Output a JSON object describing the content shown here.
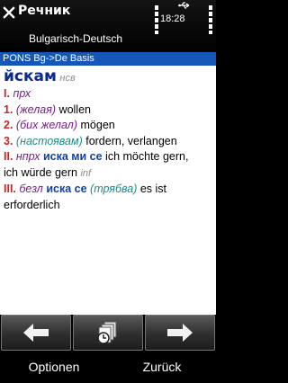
{
  "status": {
    "app_title": "Речник",
    "subtitle": "Bulgarisch-Deutsch",
    "time": "18:28"
  },
  "dictionary_bar": "PONS Bg->De Basis",
  "entry": {
    "headword": "йскам",
    "pos": "нсв",
    "sense_I_num": "I.",
    "sense_I_gram": "прх",
    "s1_num": "1.",
    "s1_gram": "(желая)",
    "s1_trans": "wollen",
    "s2_num": "2.",
    "s2_gram": "(бих желал)",
    "s2_trans": "mögen",
    "s3_num": "3.",
    "s3_gram": "(настоявам)",
    "s3_trans": "fordern, verlangen",
    "sense_II_num": "II.",
    "sense_II_gram": "нпрх",
    "sense_II_example": "иска ми се",
    "sense_II_trans_a": "ich möchte gern,",
    "sense_II_trans_b": "ich würde gern",
    "sense_II_pos": "inf",
    "sense_III_num": "III.",
    "sense_III_gram": "безл",
    "sense_III_example": "иска се",
    "sense_III_gloss": "(трябва)",
    "sense_III_trans_a": "es ist",
    "sense_III_trans_b": "erforderlich"
  },
  "softkeys": {
    "left": "Optionen",
    "right": "Zurück"
  },
  "icons": {
    "close": "close-icon",
    "back": "arrow-left-icon",
    "history": "history-icon",
    "forward": "arrow-right-icon"
  }
}
